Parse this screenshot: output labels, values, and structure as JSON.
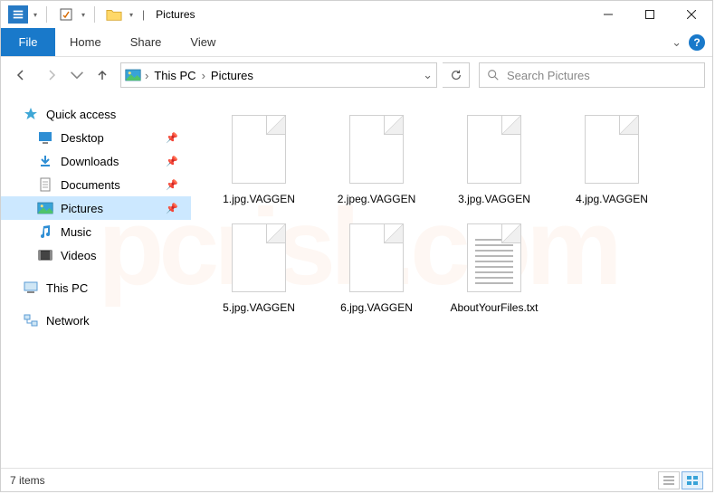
{
  "title": "Pictures",
  "ribbon": {
    "file": "File",
    "home": "Home",
    "share": "Share",
    "view": "View"
  },
  "nav": {
    "crumb_root": "This PC",
    "crumb_leaf": "Pictures"
  },
  "search": {
    "placeholder": "Search Pictures"
  },
  "sidebar": {
    "quick_access": "Quick access",
    "items": [
      {
        "label": "Desktop"
      },
      {
        "label": "Downloads"
      },
      {
        "label": "Documents"
      },
      {
        "label": "Pictures"
      },
      {
        "label": "Music"
      },
      {
        "label": "Videos"
      }
    ],
    "this_pc": "This PC",
    "network": "Network"
  },
  "files": [
    {
      "name": "1.jpg.VAGGEN",
      "type": "generic"
    },
    {
      "name": "2.jpeg.VAGGEN",
      "type": "generic"
    },
    {
      "name": "3.jpg.VAGGEN",
      "type": "generic"
    },
    {
      "name": "4.jpg.VAGGEN",
      "type": "generic"
    },
    {
      "name": "5.jpg.VAGGEN",
      "type": "generic"
    },
    {
      "name": "6.jpg.VAGGEN",
      "type": "generic"
    },
    {
      "name": "AboutYourFiles.txt",
      "type": "text"
    }
  ],
  "status": {
    "count": "7 items"
  }
}
